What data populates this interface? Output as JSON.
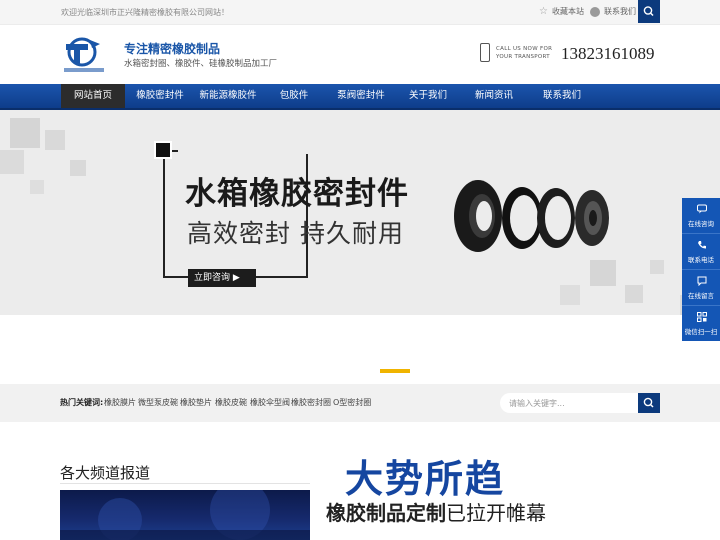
{
  "topbar": {
    "welcome": "欢迎光临深圳市正兴隆精密橡胶有限公司网站！",
    "bookmark": "收藏本站",
    "contact": "联系我们"
  },
  "header": {
    "slogan_title": "专注精密橡胶制品",
    "slogan_sub": "水箱密封圈、橡胶件、硅橡胶制品加工厂",
    "call_line1": "CALL US NOW FOR",
    "call_line2": "YOUR TRANSPORT",
    "phone": "13823161089"
  },
  "nav": {
    "items": [
      "网站首页",
      "橡胶密封件",
      "新能源橡胶件",
      "包胶件",
      "泵阀密封件",
      "关于我们",
      "新闻资讯",
      "联系我们"
    ],
    "active_index": 0
  },
  "banner": {
    "title": "水箱橡胶密封件",
    "subtitle": "高效密封 持久耐用",
    "cta": "立即咨询 ▶"
  },
  "hot": {
    "label": "热门关键词:",
    "keywords": [
      "橡胶膜片",
      "微型泵皮碗",
      "橡胶垫片",
      "橡胶皮碗",
      "橡胶伞型阀",
      "橡胶密封圈",
      "O型密封圈"
    ],
    "search_placeholder": "请输入关键字..."
  },
  "section": {
    "title": "各大频道报道",
    "promo_line1": "大势所趋",
    "promo_line2_bold": "橡胶制品定制",
    "promo_line2_rest": "已拉开帷幕"
  },
  "float_bar": {
    "items": [
      "在线咨询",
      "联系电话",
      "在线留言",
      "微信扫一扫"
    ]
  },
  "colors": {
    "brand_blue": "#1456b5",
    "nav_dark": "#0e3d8a",
    "accent_yellow": "#f0b400"
  }
}
